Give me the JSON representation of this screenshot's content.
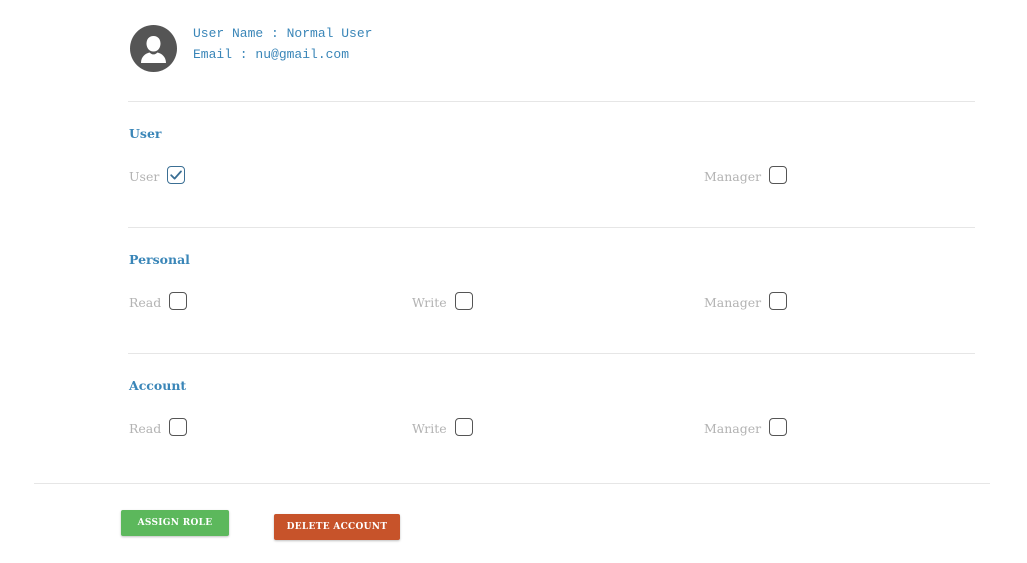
{
  "user": {
    "name_line": "User Name : Normal User",
    "email_line": "Email : nu@gmail.com"
  },
  "sections": {
    "user": {
      "title": "User",
      "perms": {
        "user": {
          "label": "User",
          "checked": true
        },
        "manager": {
          "label": "Manager",
          "checked": false
        }
      }
    },
    "personal": {
      "title": "Personal",
      "perms": {
        "read": {
          "label": "Read",
          "checked": false
        },
        "write": {
          "label": "Write",
          "checked": false
        },
        "manager": {
          "label": "Manager",
          "checked": false
        }
      }
    },
    "account": {
      "title": "Account",
      "perms": {
        "read": {
          "label": "Read",
          "checked": false
        },
        "write": {
          "label": "Write",
          "checked": false
        },
        "manager": {
          "label": "Manager",
          "checked": false
        }
      }
    }
  },
  "actions": {
    "assign_label": "ASSIGN ROLE",
    "delete_label": "DELETE ACCOUNT"
  },
  "colors": {
    "accent": "#3a86b8",
    "assign": "#5cb85c",
    "delete": "#c7532a",
    "label": "#b3b3b3"
  },
  "icons": {
    "avatar": "user-silhouette-icon",
    "check": "checkmark-icon"
  }
}
